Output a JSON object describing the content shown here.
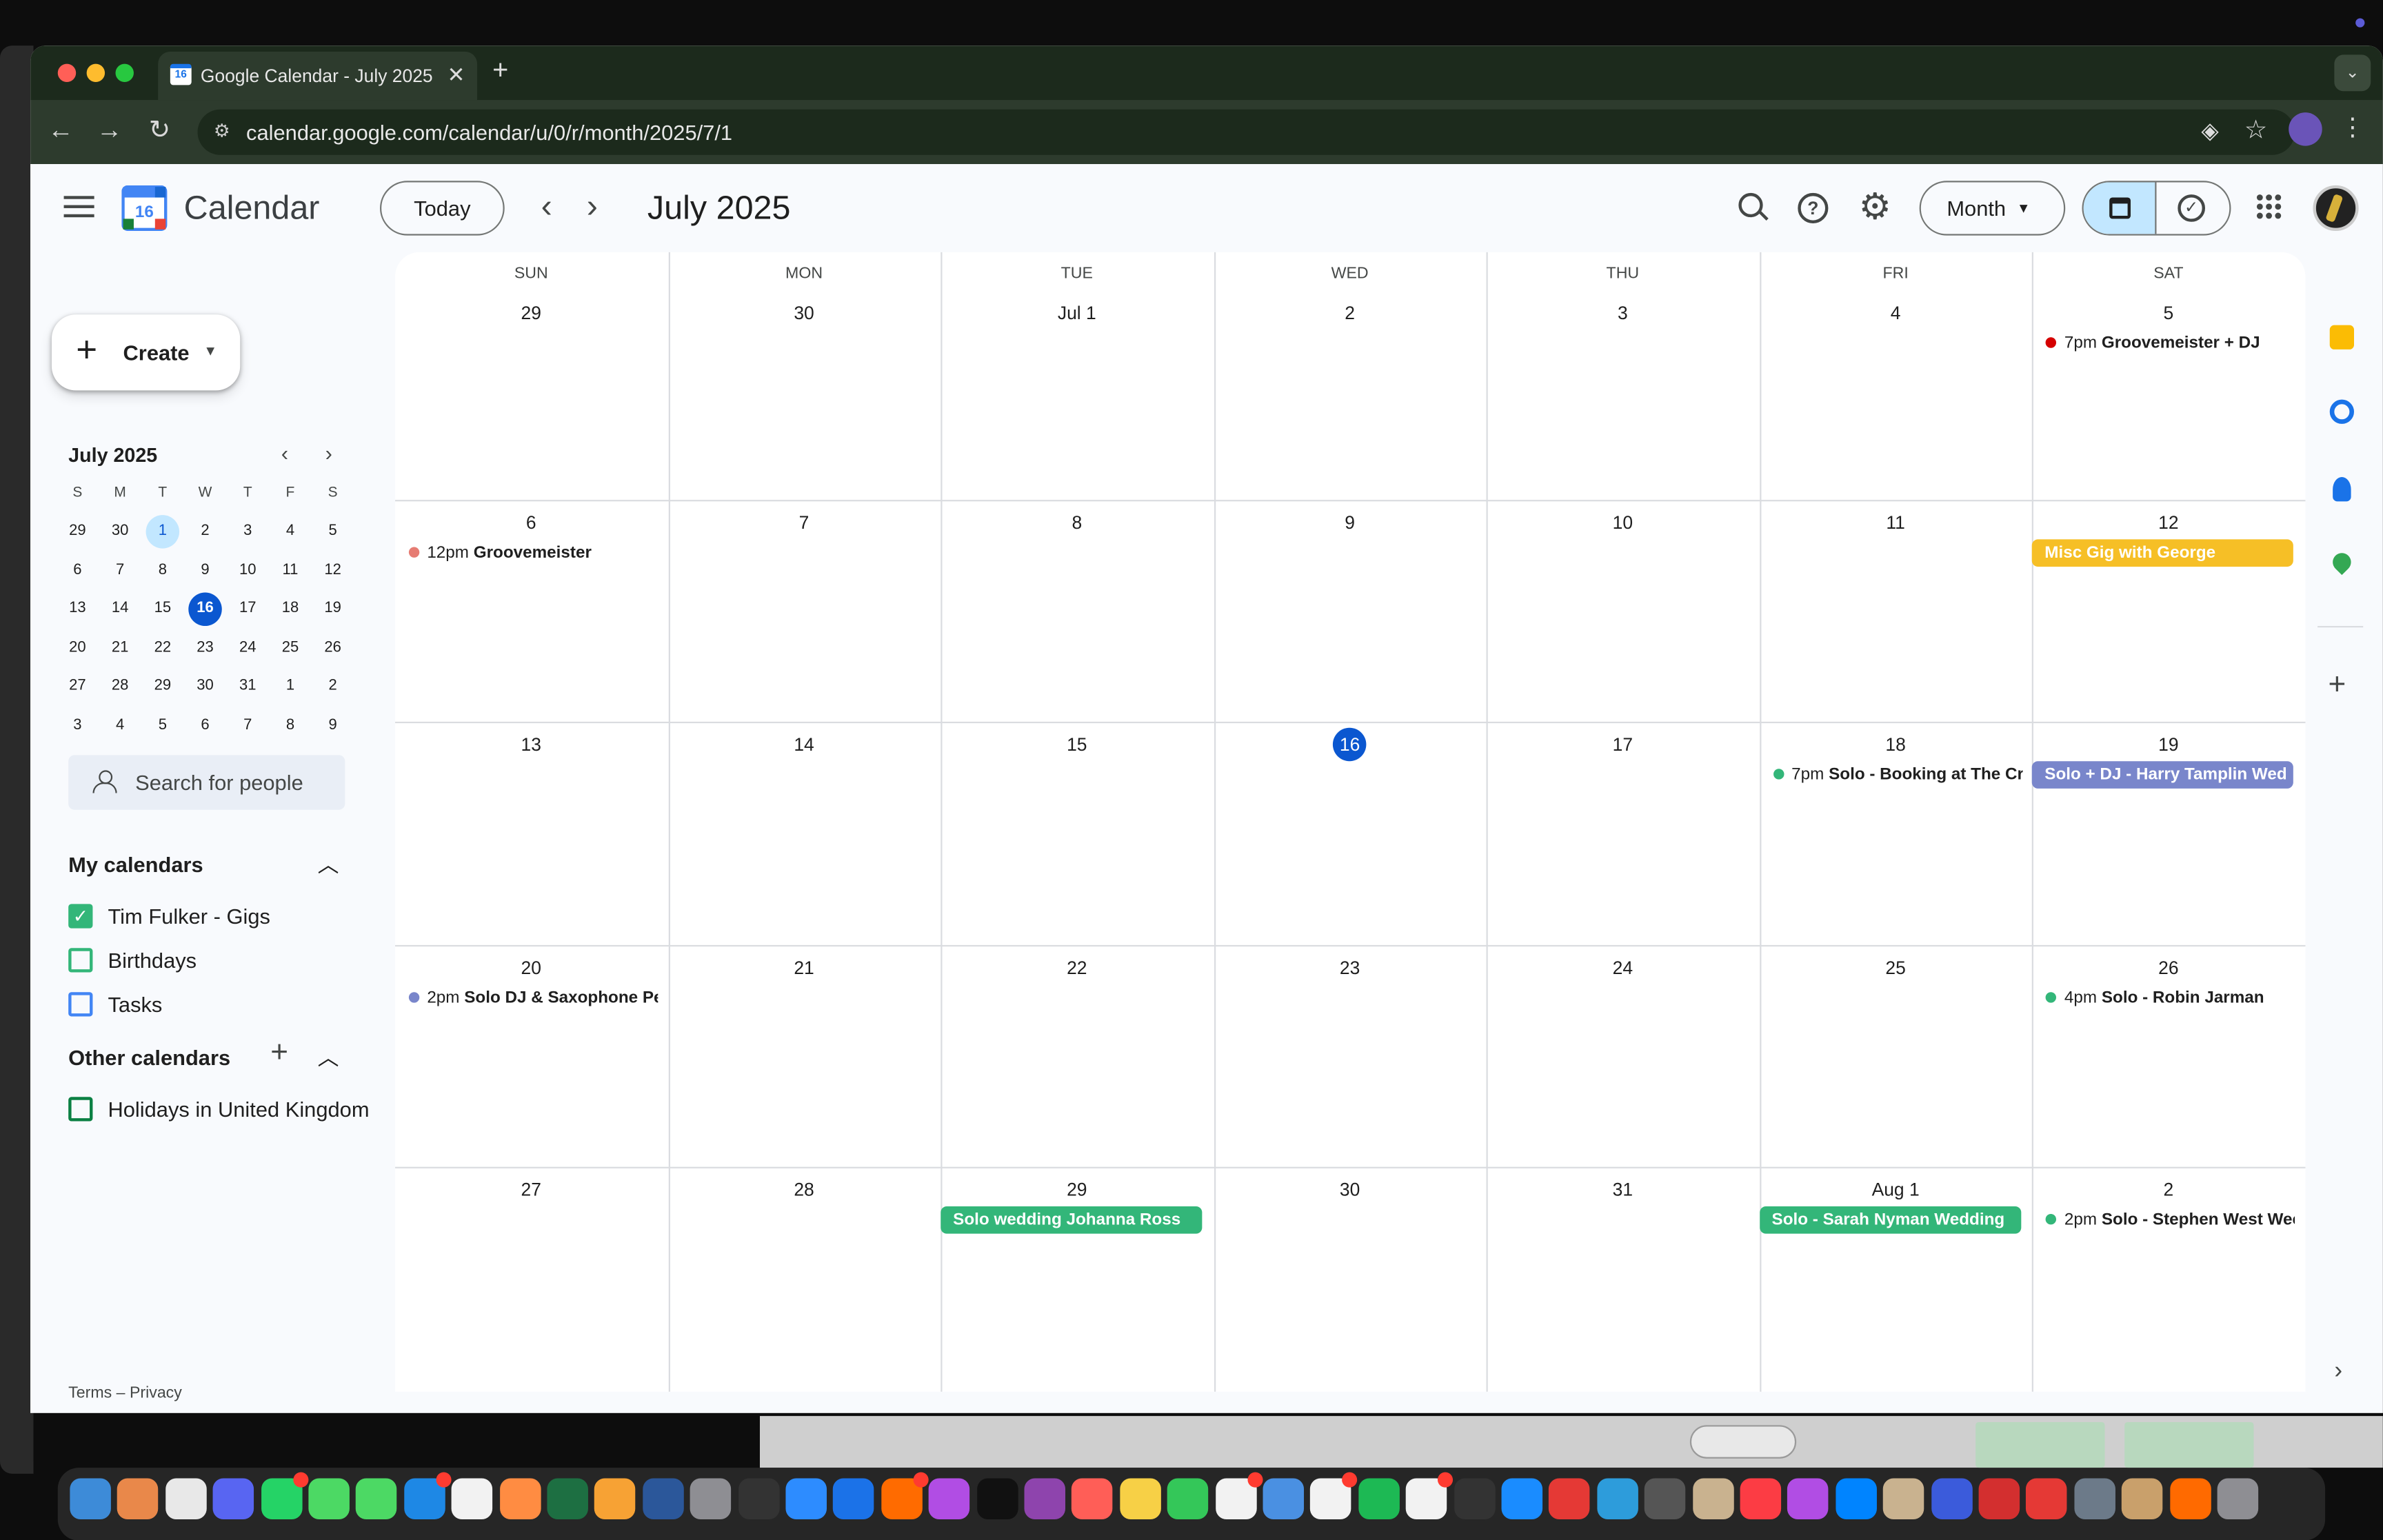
{
  "browser": {
    "tab_title": "Google Calendar - July 2025",
    "url": "calendar.google.com/calendar/u/0/r/month/2025/7/1",
    "favicon_label": "16"
  },
  "header": {
    "brand": "Calendar",
    "today_button": "Today",
    "title": "July 2025",
    "view_button": "Month"
  },
  "sidebar": {
    "create_label": "Create",
    "mini_cal": {
      "title": "July 2025",
      "dow": [
        "S",
        "M",
        "T",
        "W",
        "T",
        "F",
        "S"
      ],
      "weeks": [
        [
          "29",
          "30",
          "1",
          "2",
          "3",
          "4",
          "5"
        ],
        [
          "6",
          "7",
          "8",
          "9",
          "10",
          "11",
          "12"
        ],
        [
          "13",
          "14",
          "15",
          "16",
          "17",
          "18",
          "19"
        ],
        [
          "20",
          "21",
          "22",
          "23",
          "24",
          "25",
          "26"
        ],
        [
          "27",
          "28",
          "29",
          "30",
          "31",
          "1",
          "2"
        ],
        [
          "3",
          "4",
          "5",
          "6",
          "7",
          "8",
          "9"
        ]
      ],
      "selected": "1",
      "today": "16"
    },
    "search_people_placeholder": "Search for people",
    "my_calendars_title": "My calendars",
    "my_calendars": [
      {
        "name": "Tim Fulker - Gigs",
        "checked": true,
        "color": "#33b679"
      },
      {
        "name": "Birthdays",
        "checked": false,
        "color": "#33b679"
      },
      {
        "name": "Tasks",
        "checked": false,
        "color": "#4285f4"
      }
    ],
    "other_calendars_title": "Other calendars",
    "other_calendars": [
      {
        "name": "Holidays in United Kingdom",
        "checked": false,
        "color": "#0b8043"
      }
    ],
    "terms": "Terms",
    "privacy": "Privacy",
    "terms_sep": "–"
  },
  "grid": {
    "dow": [
      "SUN",
      "MON",
      "TUE",
      "WED",
      "THU",
      "FRI",
      "SAT"
    ],
    "weeks": [
      {
        "days": [
          "29",
          "30",
          "Jul 1",
          "2",
          "3",
          "4",
          "5"
        ]
      },
      {
        "days": [
          "6",
          "7",
          "8",
          "9",
          "10",
          "11",
          "12"
        ]
      },
      {
        "days": [
          "13",
          "14",
          "15",
          "16",
          "17",
          "18",
          "19"
        ]
      },
      {
        "days": [
          "20",
          "21",
          "22",
          "23",
          "24",
          "25",
          "26"
        ]
      },
      {
        "days": [
          "27",
          "28",
          "29",
          "30",
          "31",
          "Aug 1",
          "2"
        ]
      }
    ],
    "today": {
      "week": 2,
      "day": 3
    },
    "events": [
      {
        "week": 0,
        "day": 6,
        "style": "dot",
        "time": "7pm",
        "title": "Groovemeister + DJ",
        "color": "#d50000"
      },
      {
        "week": 1,
        "day": 0,
        "style": "dot",
        "time": "12pm",
        "title": "Groovemeister",
        "color": "#e67c73"
      },
      {
        "week": 1,
        "day": 6,
        "style": "bar",
        "title": "Misc Gig with George",
        "color": "#f6bf26"
      },
      {
        "week": 2,
        "day": 5,
        "style": "dot",
        "time": "7pm",
        "title": "Solo - Booking at The Cr",
        "color": "#33b679"
      },
      {
        "week": 2,
        "day": 6,
        "style": "bar",
        "title": "Solo + DJ - Harry Tamplin Wed",
        "color": "#7986cb"
      },
      {
        "week": 3,
        "day": 0,
        "style": "dot",
        "time": "2pm",
        "title": "Solo DJ & Saxophone Pe",
        "color": "#7986cb"
      },
      {
        "week": 3,
        "day": 6,
        "style": "dot",
        "time": "4pm",
        "title": "Solo - Robin Jarman",
        "color": "#33b679"
      },
      {
        "week": 4,
        "day": 2,
        "style": "bar",
        "title": "Solo wedding Johanna Ross",
        "color": "#33b679"
      },
      {
        "week": 4,
        "day": 5,
        "style": "bar",
        "title": "Solo - Sarah Nyman Wedding",
        "color": "#33b679"
      },
      {
        "week": 4,
        "day": 6,
        "style": "dot",
        "time": "2pm",
        "title": "Solo - Stephen West Wec",
        "color": "#33b679"
      }
    ]
  },
  "colors": {
    "accent": "#0b57d0",
    "selected": "#c2e7ff"
  }
}
